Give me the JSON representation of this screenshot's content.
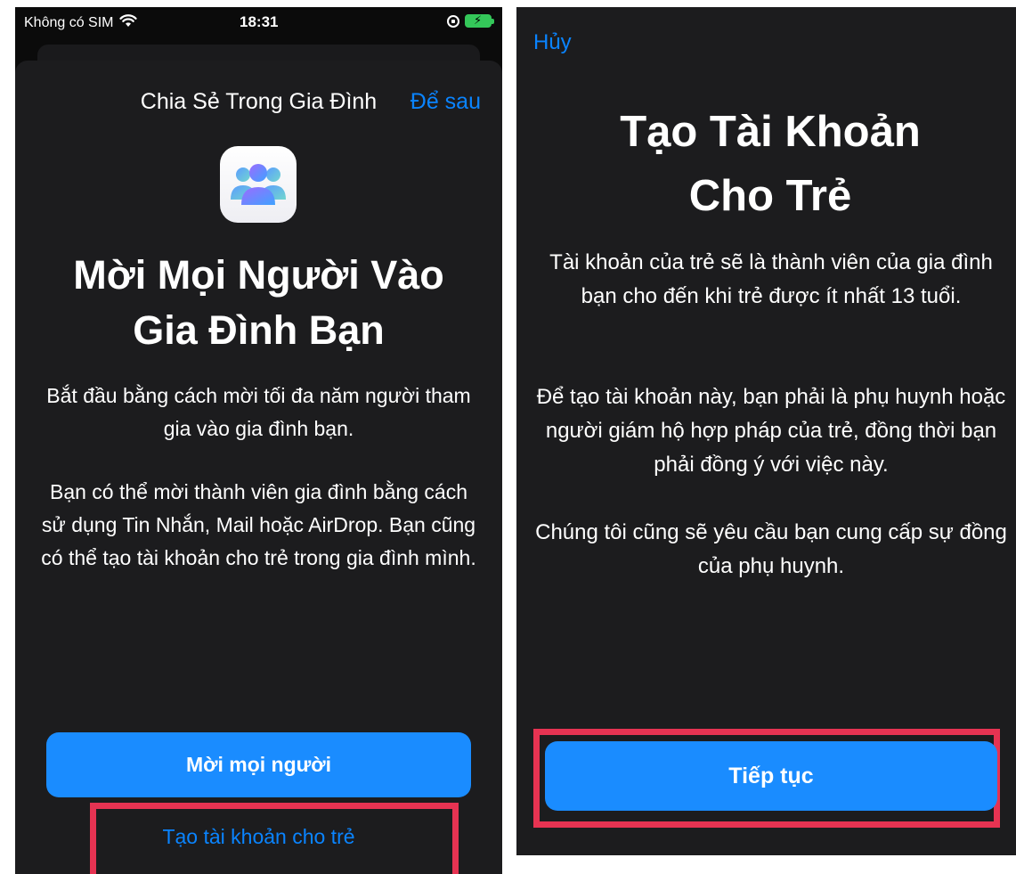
{
  "left": {
    "status_bar": {
      "carrier": "Không có SIM",
      "time": "18:31"
    },
    "sheet": {
      "title": "Chia Sẻ Trong Gia Đình",
      "later_label": "Để sau",
      "heading_line1": "Mời Mọi Người Vào",
      "heading_line2": "Gia Đình Bạn",
      "paragraph1": "Bắt đầu bằng cách mời tối đa năm người tham gia vào gia đình bạn.",
      "paragraph2": "Bạn có thể mời thành viên gia đình bằng cách sử dụng Tin Nhắn, Mail hoặc AirDrop. Bạn cũng có thể tạo tài khoản cho trẻ trong gia đình mình.",
      "invite_button_label": "Mời mọi người",
      "create_child_label": "Tạo tài khoản cho trẻ"
    }
  },
  "right": {
    "cancel_label": "Hủy",
    "heading_line1": "Tạo Tài Khoản",
    "heading_line2": "Cho Trẻ",
    "paragraph1": "Tài khoản của trẻ sẽ là thành viên của gia đình bạn cho đến khi trẻ được ít nhất 13 tuổi.",
    "paragraph2": "Để tạo tài khoản này, bạn phải là phụ huynh hoặc người giám hộ hợp pháp của trẻ, đồng thời bạn phải đồng ý với việc này.",
    "paragraph3": "Chúng tôi cũng sẽ yêu cầu bạn cung cấp sự đồng của phụ huynh.",
    "continue_button_label": "Tiếp tục"
  },
  "colors": {
    "accent_blue": "#0a84ff",
    "button_blue": "#1a8cff",
    "highlight_red": "#e63352",
    "sheet_background": "#1c1c1e"
  },
  "icons": {
    "wifi": "wifi-icon",
    "orientation_lock": "orientation-lock-icon",
    "battery": "battery-charging-icon",
    "family": "family-sharing-icon"
  }
}
